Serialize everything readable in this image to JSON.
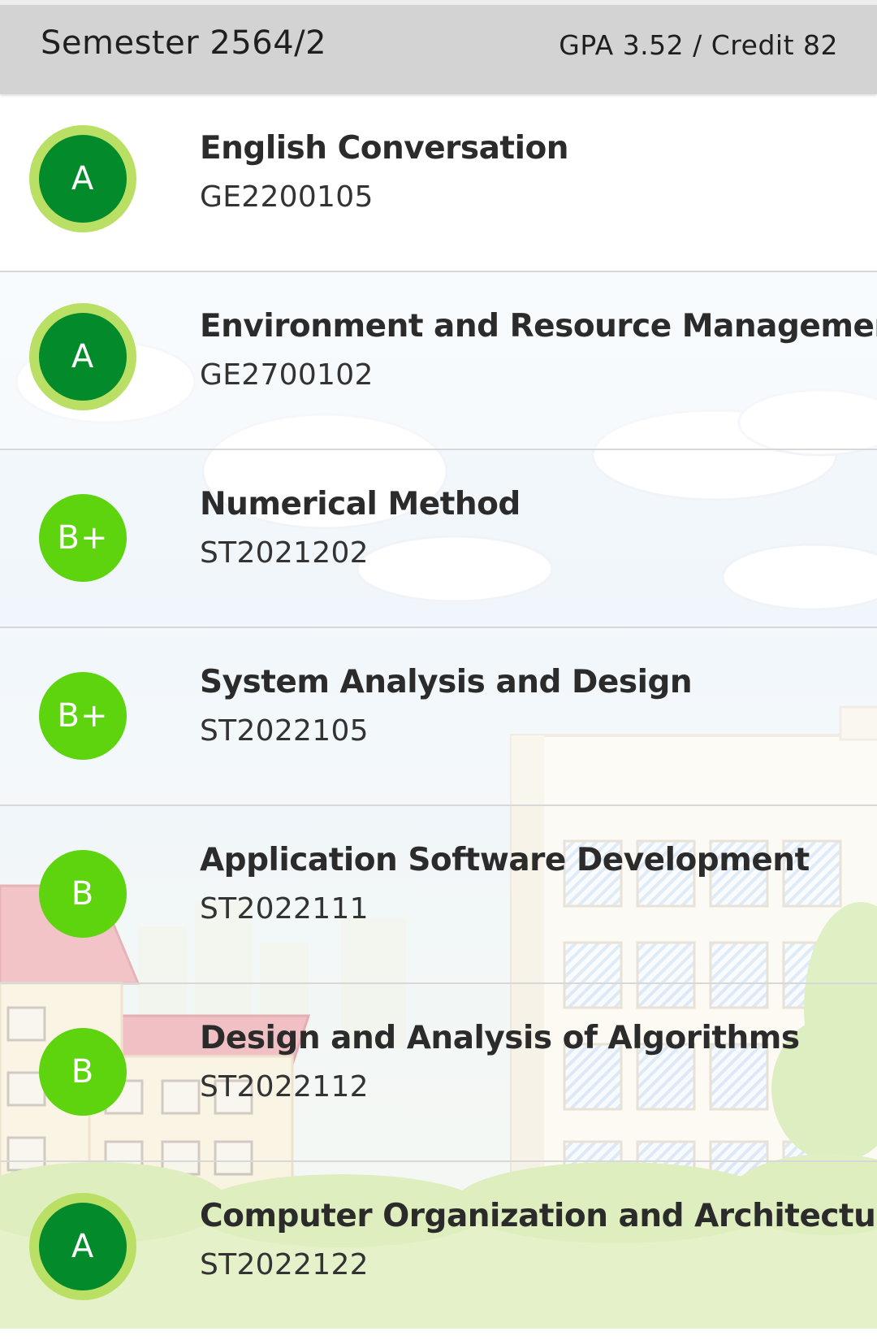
{
  "header": {
    "semester_label": "Semester 2564/2",
    "gpa_credit": "GPA 3.52 / Credit 82"
  },
  "colors": {
    "grade_A_fill": "#038a2a",
    "grade_A_ring": "#b9e065",
    "grade_B_fill": "#5dd40e",
    "header_bg": "#d3d3d3"
  },
  "courses": [
    {
      "grade": "A",
      "name": "English Conversation",
      "code": "GE2200105"
    },
    {
      "grade": "A",
      "name": "Environment and Resource Management",
      "code": "GE2700102"
    },
    {
      "grade": "B+",
      "name": "Numerical Method",
      "code": "ST2021202"
    },
    {
      "grade": "B+",
      "name": "System Analysis and Design",
      "code": "ST2022105"
    },
    {
      "grade": "B",
      "name": "Application Software Development",
      "code": "ST2022111"
    },
    {
      "grade": "B",
      "name": "Design and Analysis of Algorithms",
      "code": "ST2022112"
    },
    {
      "grade": "A",
      "name": "Computer Organization and Architecture",
      "code": "ST2022122"
    }
  ],
  "background": {
    "illustration": "cartoon-campus-scene"
  }
}
